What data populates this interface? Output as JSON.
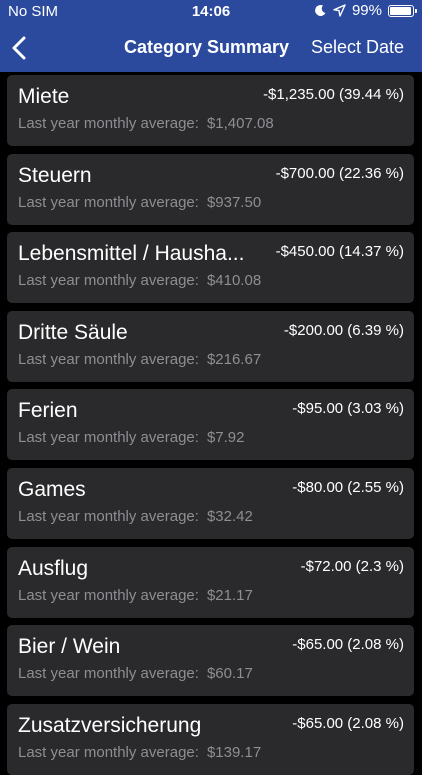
{
  "status": {
    "carrier": "No SIM",
    "time": "14:06",
    "battery": "99%",
    "battery_level": 0.99
  },
  "nav": {
    "back_icon": "chevron-left-icon",
    "title": "Category Summary",
    "action": "Select Date"
  },
  "categories": [
    {
      "name": "Miete",
      "amount": "-$1,235.00 (39.44 %)",
      "avg_label": "Last year monthly average:",
      "avg_value": "$1,407.08"
    },
    {
      "name": "Steuern",
      "amount": "-$700.00 (22.36 %)",
      "avg_label": "Last year monthly average:",
      "avg_value": "$937.50"
    },
    {
      "name": "Lebensmittel / Hausha...",
      "amount": "-$450.00 (14.37 %)",
      "avg_label": "Last year monthly average:",
      "avg_value": "$410.08"
    },
    {
      "name": "Dritte Säule",
      "amount": "-$200.00 (6.39 %)",
      "avg_label": "Last year monthly average:",
      "avg_value": "$216.67"
    },
    {
      "name": "Ferien",
      "amount": "-$95.00 (3.03 %)",
      "avg_label": "Last year monthly average:",
      "avg_value": "$7.92"
    },
    {
      "name": "Games",
      "amount": "-$80.00 (2.55 %)",
      "avg_label": "Last year monthly average:",
      "avg_value": "$32.42"
    },
    {
      "name": "Ausflug",
      "amount": "-$72.00 (2.3 %)",
      "avg_label": "Last year monthly average:",
      "avg_value": "$21.17"
    },
    {
      "name": "Bier / Wein",
      "amount": "-$65.00 (2.08 %)",
      "avg_label": "Last year monthly average:",
      "avg_value": "$60.17"
    },
    {
      "name": "Zusatzversicherung",
      "amount": "-$65.00 (2.08 %)",
      "avg_label": "Last year monthly average:",
      "avg_value": "$139.17"
    }
  ]
}
